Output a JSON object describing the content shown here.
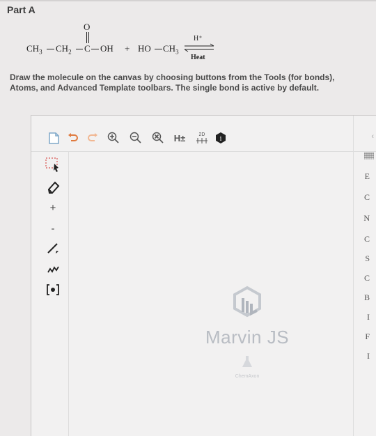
{
  "part": {
    "title": "Part A"
  },
  "reaction": {
    "ch3": "CH",
    "ch3_sub": "3",
    "ch2": "CH",
    "ch2_sub": "2",
    "o_top": "O",
    "c": "C",
    "oh": "OH",
    "plus": "+",
    "ho": "HO",
    "ch3b": "CH",
    "ch3b_sub": "3",
    "catalyst": "H⁺",
    "condition": "Heat"
  },
  "question": {
    "text": "Draw the molecule on the canvas by choosing buttons from the Tools (for bonds), Atoms, and Advanced Template toolbars. The single bond is active by default."
  },
  "editor": {
    "watermark": "Marvin JS",
    "watermark_sub": "ChemAxon",
    "top_toolbar": {
      "new_icon": "document-icon",
      "undo_icon": "undo-icon",
      "redo_icon": "redo-icon",
      "zoom_in_icon": "zoom-in-icon",
      "zoom_out_icon": "zoom-out-icon",
      "zoom_fit_icon": "zoom-fit-icon",
      "hydrogens_label": "H±",
      "clean2d_label": "2D",
      "info_icon": "info-icon"
    },
    "left_toolbar": {
      "plus_label": "+",
      "minus_label": "-"
    },
    "right_toolbar": {
      "atoms": [
        "E",
        "C",
        "N",
        "C",
        "S",
        "C",
        "B",
        "I",
        "F",
        "I"
      ]
    }
  }
}
